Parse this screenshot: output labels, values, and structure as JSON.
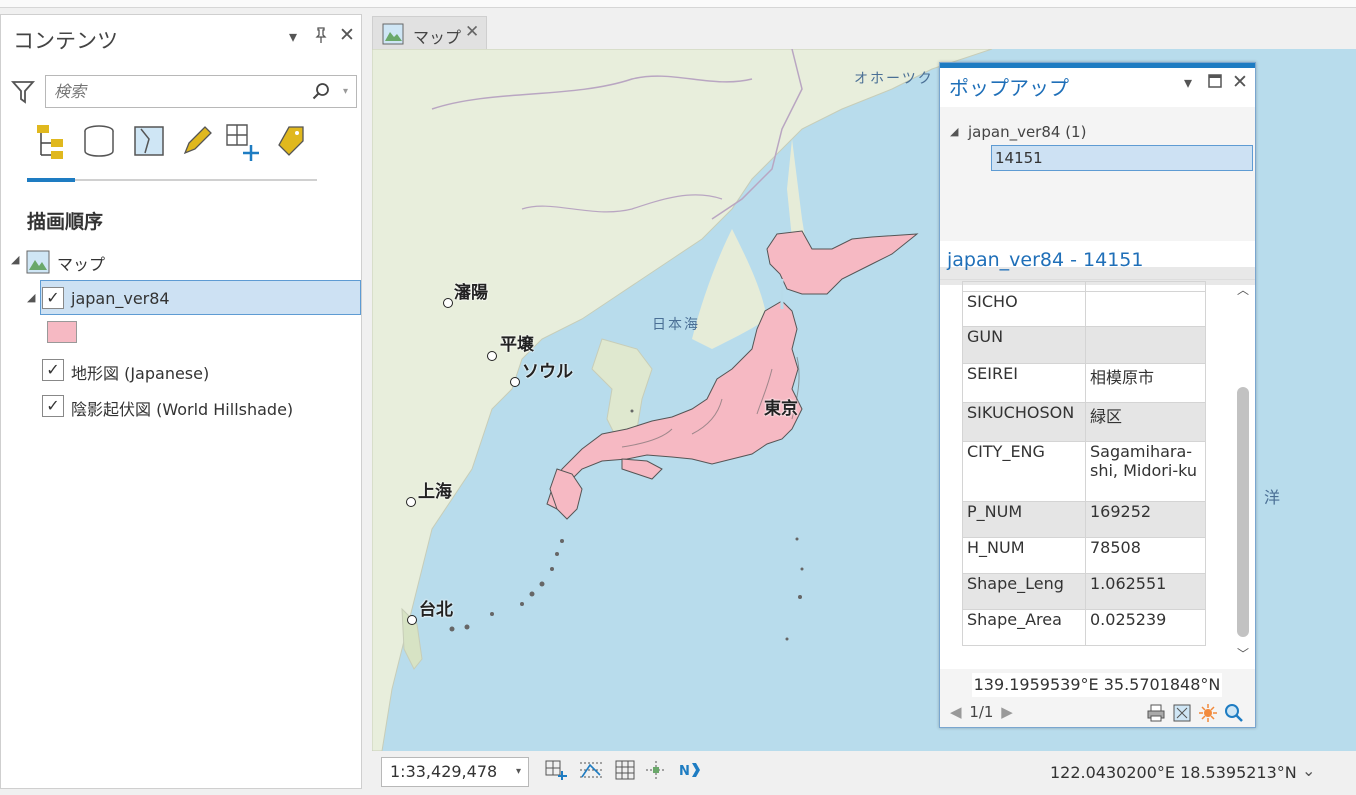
{
  "contents": {
    "title": "コンテンツ",
    "search_placeholder": "検索",
    "section_title": "描画順序",
    "map_node": "マップ",
    "layers": [
      {
        "name": "japan_ver84",
        "checked": true,
        "selected": true
      },
      {
        "name": "地形図 (Japanese)",
        "checked": true
      },
      {
        "name": "陰影起伏図 (World Hillshade)",
        "checked": true
      }
    ],
    "symbol_color": "#f6b9c3"
  },
  "map_tab": {
    "label": "マップ"
  },
  "map": {
    "labels": {
      "okhotsk": "オホーツク",
      "sea_of_japan": "日本海",
      "ocean_fragment": "洋",
      "shenyang": "瀋陽",
      "pyongyang": "平壌",
      "seoul": "ソウル",
      "shanghai": "上海",
      "taipei": "台北",
      "tokyo": "東京"
    }
  },
  "popup": {
    "title": "ポップアップ",
    "layer_node": "japan_ver84  (1)",
    "feature_id": "14151",
    "feature_title": "japan_ver84 - 14151",
    "attributes": [
      {
        "key": "SICHO",
        "value": ""
      },
      {
        "key": "GUN",
        "value": ""
      },
      {
        "key": "SEIREI",
        "value": "相模原市"
      },
      {
        "key": "SIKUCHOSON",
        "value": "緑区"
      },
      {
        "key": "CITY_ENG",
        "value": "Sagamihara-shi, Midori-ku"
      },
      {
        "key": "P_NUM",
        "value": "169252"
      },
      {
        "key": "H_NUM",
        "value": "78508"
      },
      {
        "key": "Shape_Leng",
        "value": "1.062551"
      },
      {
        "key": "Shape_Area",
        "value": "0.025239"
      }
    ],
    "coordinate": "139.1959539°E 35.5701848°N",
    "nav": "1/1"
  },
  "statusbar": {
    "scale": "1:33,429,478",
    "coordinate": "122.0430200°E 18.5395213°N"
  },
  "colors": {
    "accent": "#1e7cc2",
    "selection": "#cde1f3",
    "polygon_fill": "#f6b9c3",
    "sea": "#b8dcec"
  }
}
